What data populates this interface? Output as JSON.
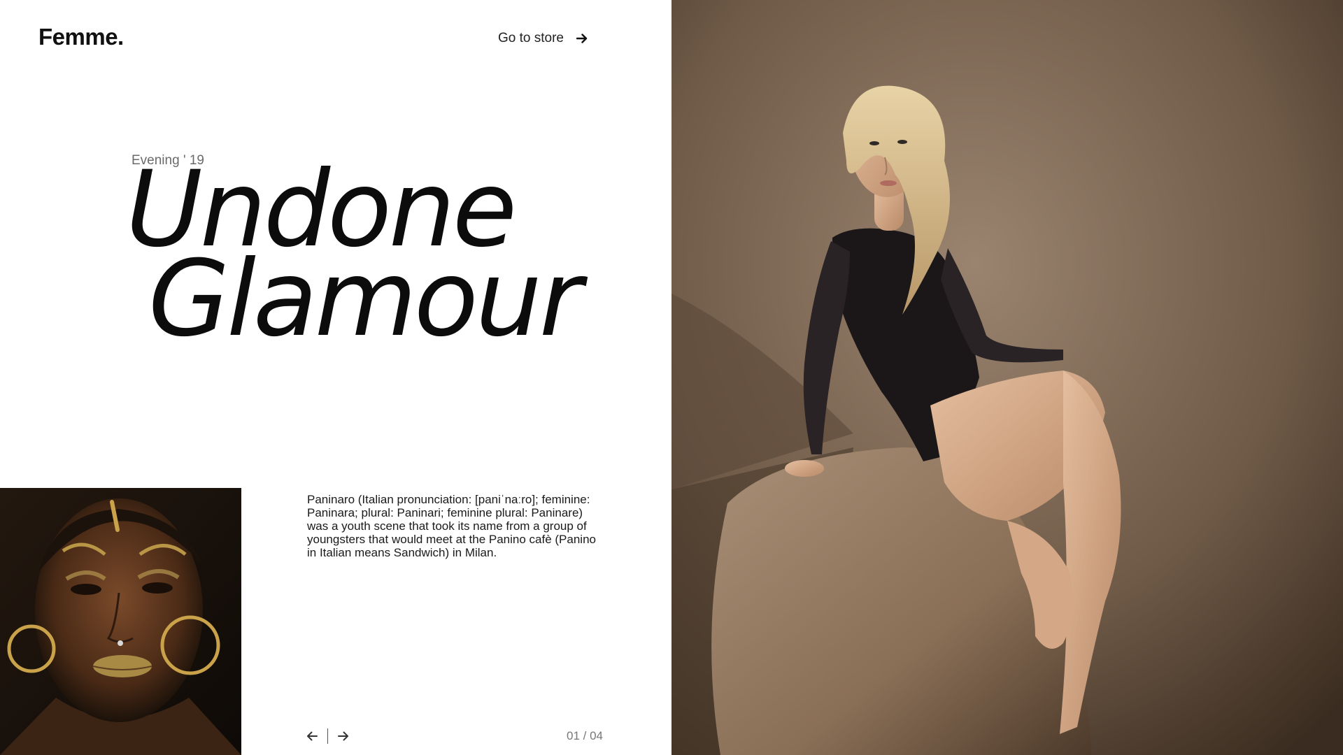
{
  "brand": {
    "logo": "Femme."
  },
  "nav": {
    "store_label": "Go to store"
  },
  "hero": {
    "kicker": "Evening ' 19",
    "title_line1": "Undone",
    "title_line2": "Glamour",
    "description": "Paninaro (Italian pronunciation: [paniˈnaːro]; feminine: Paninara; plural: Paninari; feminine plural: Paninare) was a youth scene that took its name from a group of youngsters that would meet at the Panino cafè (Panino in Italian means Sandwich) in Milan."
  },
  "pager": {
    "prev_icon": "arrow-left-icon",
    "next_icon": "arrow-right-icon",
    "counter": "01 / 04"
  },
  "images": {
    "hero": "woman-in-black-bodysuit-on-rock",
    "thumbnail": "woman-with-gold-makeup-and-hoop-earrings"
  },
  "colors": {
    "background": "#ffffff",
    "text": "#111111",
    "muted": "#777777"
  }
}
